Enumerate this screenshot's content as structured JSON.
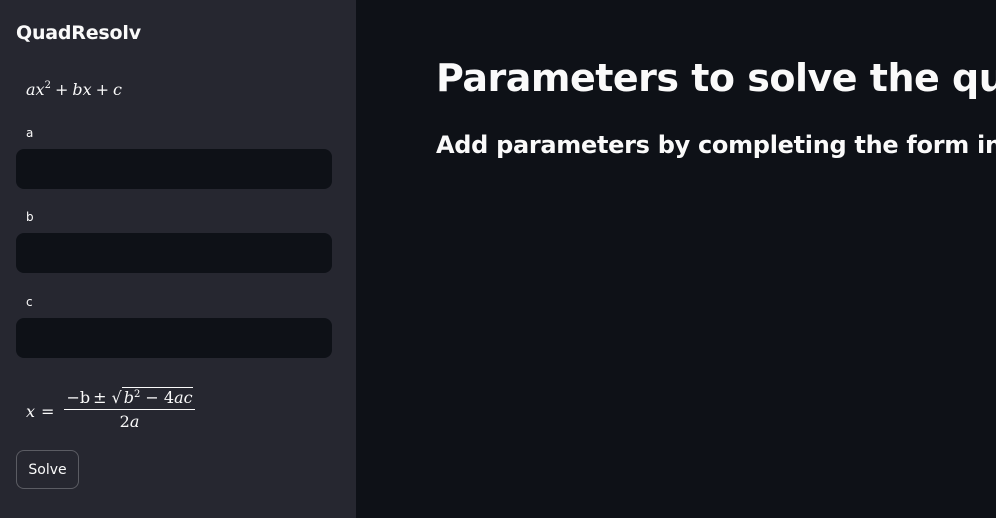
{
  "sidebar": {
    "app_title": "QuadResolv",
    "equation": {
      "a": "a",
      "x": "x",
      "exp": "2",
      "plus1": "+",
      "b": "b",
      "x2": "x",
      "plus2": "+",
      "c": "c"
    },
    "fields": [
      {
        "label": "a",
        "value": "",
        "placeholder": ""
      },
      {
        "label": "b",
        "value": "",
        "placeholder": ""
      },
      {
        "label": "c",
        "value": "",
        "placeholder": ""
      }
    ],
    "quadratic_formula": {
      "lhs": "x",
      "eq": "=",
      "neg_b": "−b",
      "pm": "±",
      "sqrt": "√",
      "b": "b",
      "exp": "2",
      "minus": " − ",
      "four": "4",
      "ac": "ac",
      "two": "2",
      "a": "a"
    },
    "solve_label": "Solve"
  },
  "main": {
    "title": "Parameters to solve the quadratic equation",
    "subtitle": "Add parameters by completing the form in the sidebar"
  },
  "colors": {
    "sidebar_bg": "#262730",
    "main_bg": "#0e1117",
    "input_bg": "#0e1117",
    "text": "#fafafa"
  }
}
